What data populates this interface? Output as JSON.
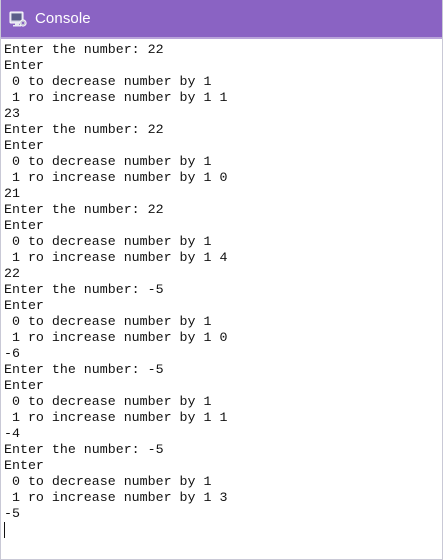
{
  "window": {
    "title": "Console",
    "title_icon": "console-app-icon",
    "titlebar_color": "#8a63c3",
    "title_text_color": "#ffffff"
  },
  "console": {
    "lines": [
      "Enter the number: 22",
      "Enter",
      " 0 to decrease number by 1",
      " 1 ro increase number by 1 1",
      "23",
      "Enter the number: 22",
      "Enter",
      " 0 to decrease number by 1",
      " 1 ro increase number by 1 0",
      "21",
      "Enter the number: 22",
      "Enter",
      " 0 to decrease number by 1",
      " 1 ro increase number by 1 4",
      "22",
      "Enter the number: -5",
      "Enter",
      " 0 to decrease number by 1",
      " 1 ro increase number by 1 0",
      "-6",
      "Enter the number: -5",
      "Enter",
      " 0 to decrease number by 1",
      " 1 ro increase number by 1 1",
      "-4",
      "Enter the number: -5",
      "Enter",
      " 0 to decrease number by 1",
      " 1 ro increase number by 1 3",
      "-5"
    ]
  }
}
